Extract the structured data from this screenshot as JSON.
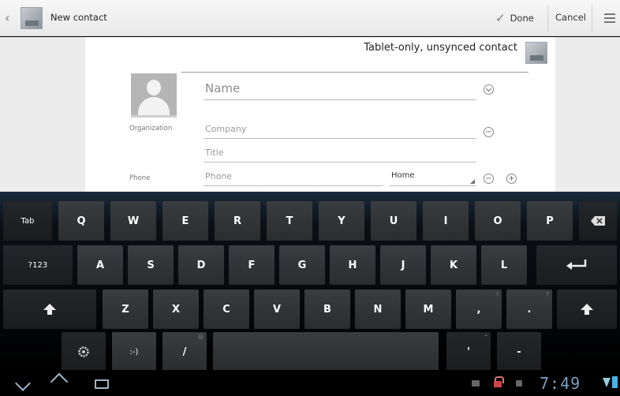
{
  "action_bar": {
    "title": "New contact",
    "done_label": "Done",
    "cancel_label": "Cancel",
    "icons": [
      "back-chevron-icon",
      "contacts-app-icon",
      "check-icon",
      "overflow-menu-icon"
    ]
  },
  "form": {
    "account_label": "Tablet-only, unsynced contact",
    "name_placeholder": "Name",
    "organization_label": "Organization",
    "company_placeholder": "Company",
    "title_placeholder": "Title",
    "phone_label": "Phone",
    "phone_placeholder": "Phone",
    "phone_type": "Home"
  },
  "keyboard": {
    "row1": [
      "Tab",
      "Q",
      "W",
      "E",
      "R",
      "T",
      "Y",
      "U",
      "I",
      "O",
      "P"
    ],
    "row2": [
      "?123",
      "A",
      "S",
      "D",
      "F",
      "G",
      "H",
      "J",
      "K",
      "L"
    ],
    "row3": [
      "Z",
      "X",
      "C",
      "V",
      "B",
      "N",
      "M",
      ",",
      "."
    ],
    "row3_hints": [
      "!",
      "?"
    ],
    "row4": [
      ":-)",
      "/",
      "'",
      "-"
    ],
    "row4_hints": [
      "@",
      "\""
    ]
  },
  "system_bar": {
    "clock": "7:49",
    "colors": {
      "clock": "#7aa0bd",
      "battery": "#4ab3e6",
      "nav": "#9db4c4"
    }
  }
}
